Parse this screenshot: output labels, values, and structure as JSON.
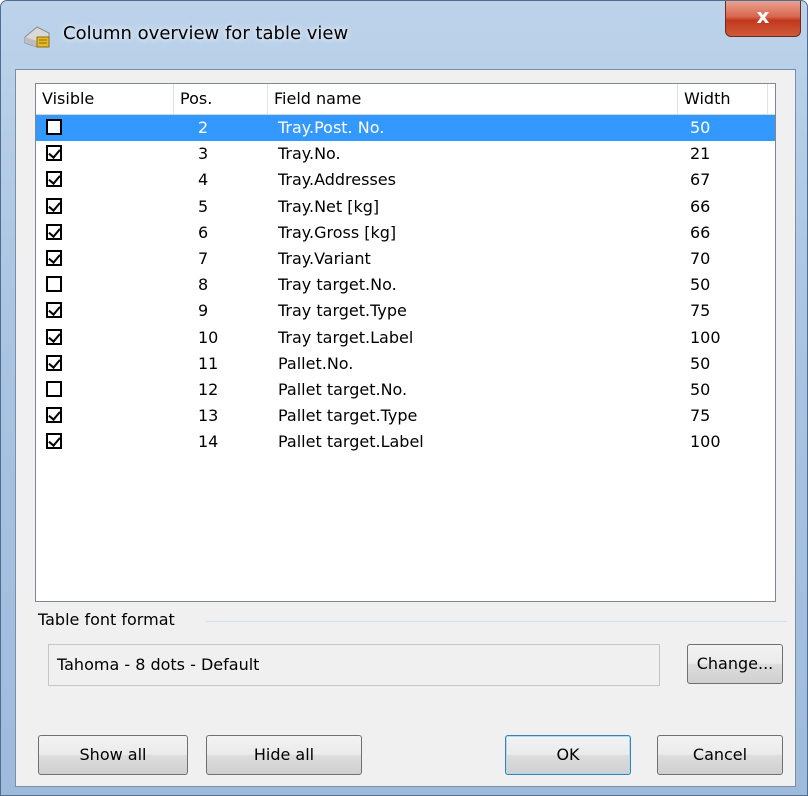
{
  "window": {
    "title": "Column overview for table view",
    "close_label": "x"
  },
  "columns": {
    "visible": "Visible",
    "pos": "Pos.",
    "field_name": "Field name",
    "width": "Width"
  },
  "rows": [
    {
      "visible": false,
      "pos": "2",
      "field": "Tray.Post. No.",
      "width": "50",
      "selected": true
    },
    {
      "visible": true,
      "pos": "3",
      "field": "Tray.No.",
      "width": "21",
      "selected": false
    },
    {
      "visible": true,
      "pos": "4",
      "field": "Tray.Addresses",
      "width": "67",
      "selected": false
    },
    {
      "visible": true,
      "pos": "5",
      "field": "Tray.Net [kg]",
      "width": "66",
      "selected": false
    },
    {
      "visible": true,
      "pos": "6",
      "field": "Tray.Gross [kg]",
      "width": "66",
      "selected": false
    },
    {
      "visible": true,
      "pos": "7",
      "field": "Tray.Variant",
      "width": "70",
      "selected": false
    },
    {
      "visible": false,
      "pos": "8",
      "field": "Tray target.No.",
      "width": "50",
      "selected": false
    },
    {
      "visible": true,
      "pos": "9",
      "field": "Tray target.Type",
      "width": "75",
      "selected": false
    },
    {
      "visible": true,
      "pos": "10",
      "field": "Tray target.Label",
      "width": "100",
      "selected": false
    },
    {
      "visible": true,
      "pos": "11",
      "field": "Pallet.No.",
      "width": "50",
      "selected": false
    },
    {
      "visible": false,
      "pos": "12",
      "field": "Pallet target.No.",
      "width": "50",
      "selected": false
    },
    {
      "visible": true,
      "pos": "13",
      "field": "Pallet target.Type",
      "width": "75",
      "selected": false
    },
    {
      "visible": true,
      "pos": "14",
      "field": "Pallet target.Label",
      "width": "100",
      "selected": false
    }
  ],
  "font_group": {
    "label": "Table font format",
    "value": "Tahoma - 8 dots - Default",
    "change_label": "Change..."
  },
  "buttons": {
    "show_all": "Show all",
    "hide_all": "Hide all",
    "ok": "OK",
    "cancel": "Cancel"
  },
  "colors": {
    "selection": "#3399ff",
    "close_button": "#c2381c"
  }
}
